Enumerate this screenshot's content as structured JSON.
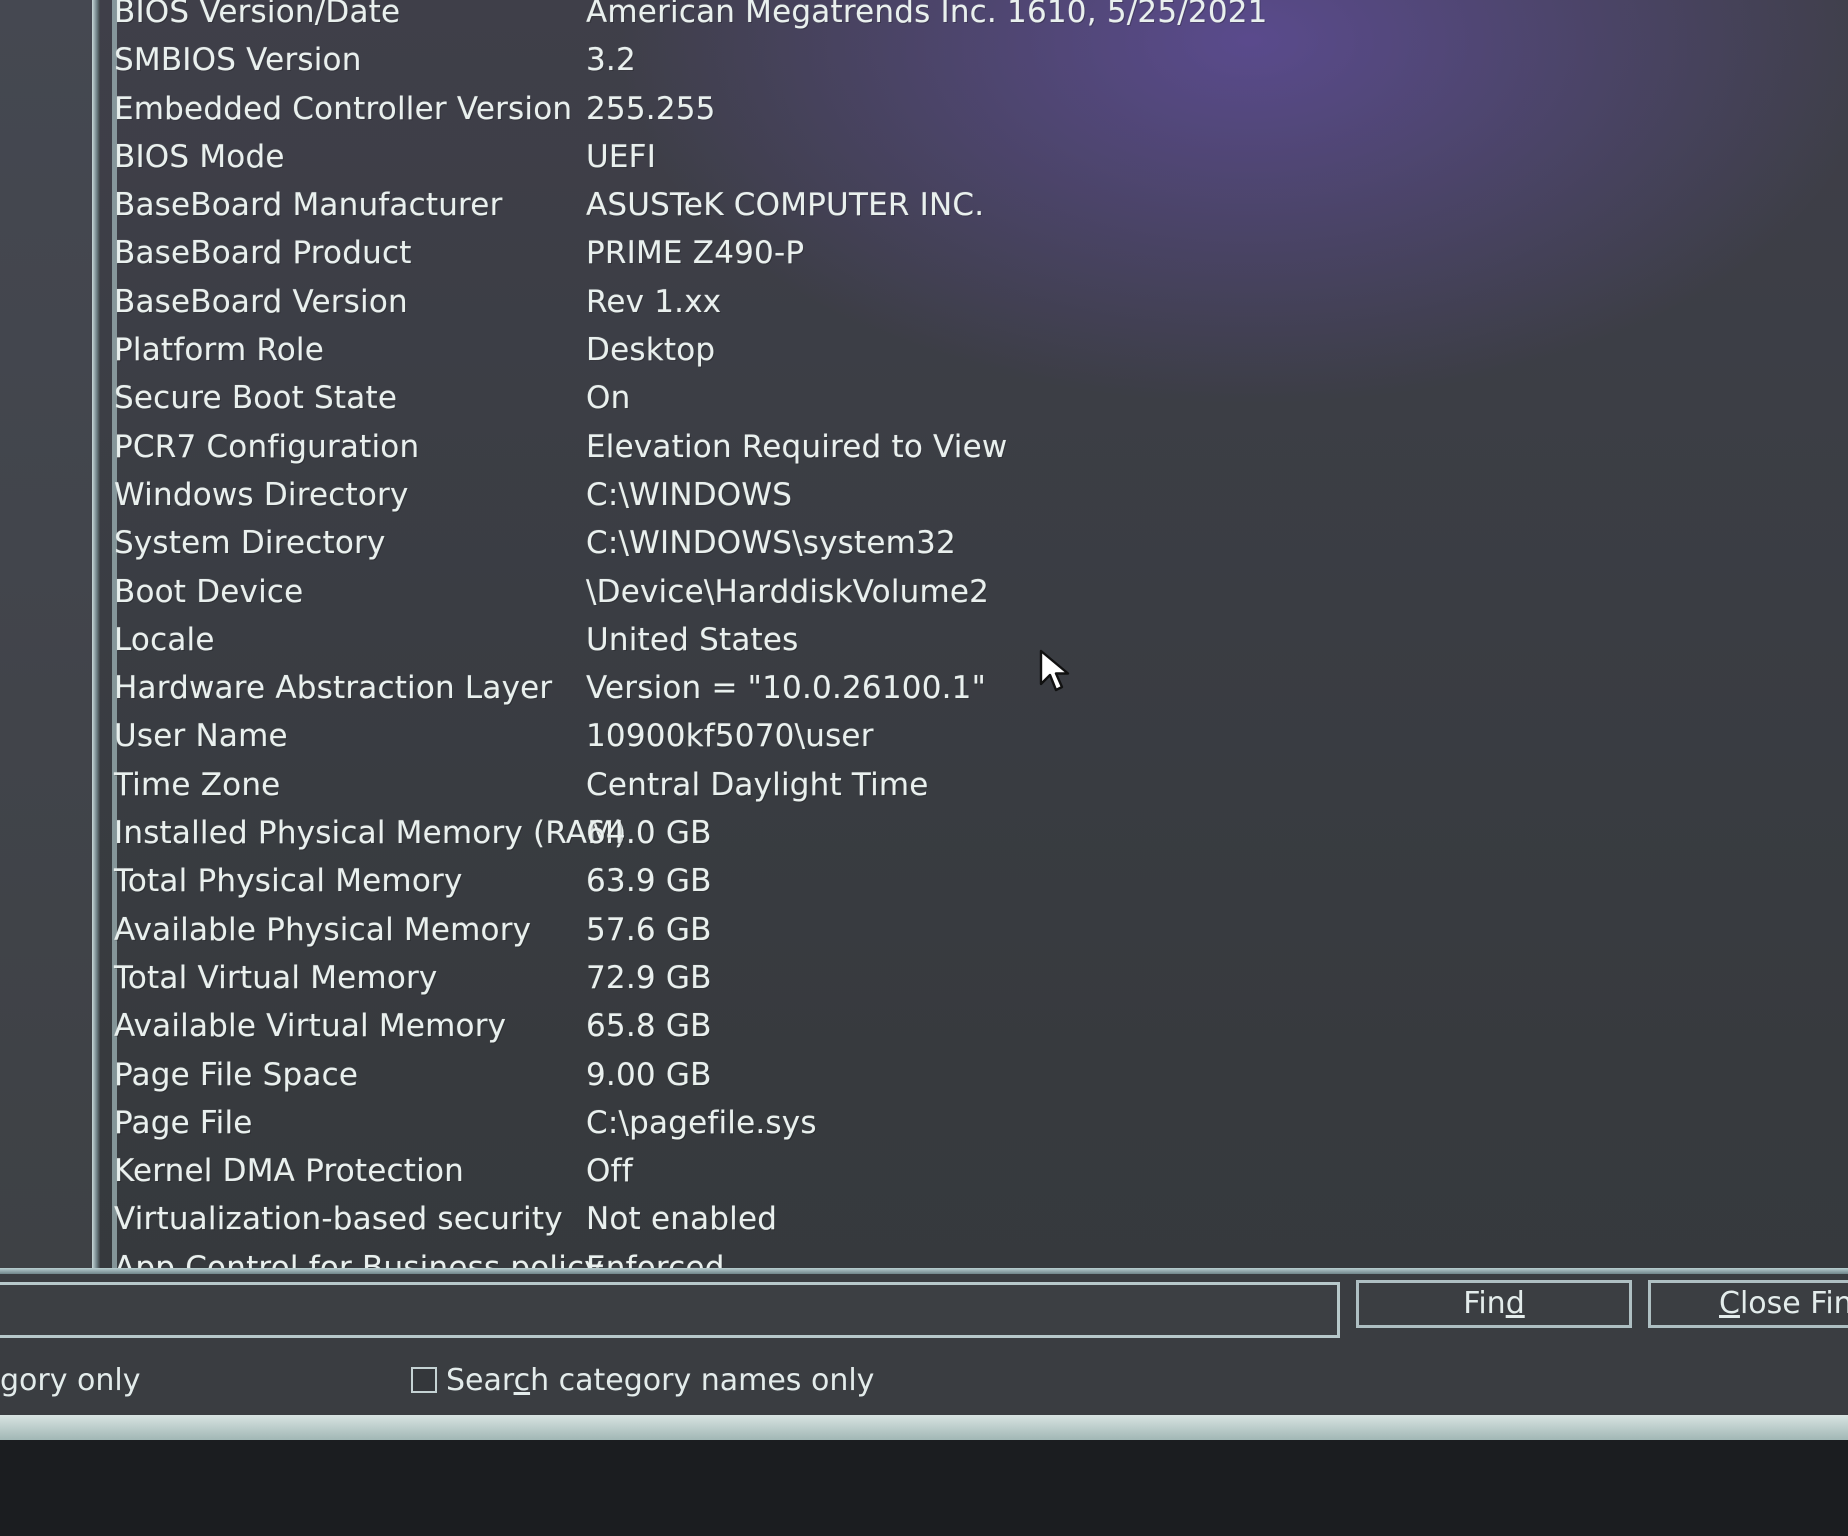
{
  "system_summary": {
    "rows": [
      {
        "item": "BIOS Version/Date",
        "value": "American Megatrends Inc. 1610, 5/25/2021"
      },
      {
        "item": "SMBIOS Version",
        "value": "3.2"
      },
      {
        "item": "Embedded Controller Version",
        "value": "255.255"
      },
      {
        "item": "BIOS Mode",
        "value": "UEFI"
      },
      {
        "item": "BaseBoard Manufacturer",
        "value": "ASUSTeK COMPUTER INC."
      },
      {
        "item": "BaseBoard Product",
        "value": "PRIME Z490-P"
      },
      {
        "item": "BaseBoard Version",
        "value": "Rev 1.xx"
      },
      {
        "item": "Platform Role",
        "value": "Desktop"
      },
      {
        "item": "Secure Boot State",
        "value": "On"
      },
      {
        "item": "PCR7 Configuration",
        "value": "Elevation Required to View"
      },
      {
        "item": "Windows Directory",
        "value": "C:\\WINDOWS"
      },
      {
        "item": "System Directory",
        "value": "C:\\WINDOWS\\system32"
      },
      {
        "item": "Boot Device",
        "value": "\\Device\\HarddiskVolume2"
      },
      {
        "item": "Locale",
        "value": "United States"
      },
      {
        "item": "Hardware Abstraction Layer",
        "value": "Version = \"10.0.26100.1\""
      },
      {
        "item": "User Name",
        "value": "10900kf5070\\user"
      },
      {
        "item": "Time Zone",
        "value": "Central Daylight Time"
      },
      {
        "item": "Installed Physical Memory (RAM)",
        "value": "64.0 GB"
      },
      {
        "item": "Total Physical Memory",
        "value": "63.9 GB"
      },
      {
        "item": "Available Physical Memory",
        "value": "57.6 GB"
      },
      {
        "item": "Total Virtual Memory",
        "value": "72.9 GB"
      },
      {
        "item": "Available Virtual Memory",
        "value": "65.8 GB"
      },
      {
        "item": "Page File Space",
        "value": "9.00 GB"
      },
      {
        "item": "Page File",
        "value": "C:\\pagefile.sys"
      },
      {
        "item": "Kernel DMA Protection",
        "value": "Off"
      },
      {
        "item": "Virtualization-based security",
        "value": "Not enabled"
      },
      {
        "item": "App Control for Business policy",
        "value": "Enforced"
      }
    ]
  },
  "find_bar": {
    "input_value": "",
    "find_button": {
      "prefix": "Fin",
      "accel": "d",
      "suffix": ""
    },
    "close_find_button": {
      "accel": "C",
      "rest": "lose Finc"
    },
    "option_category_only": "gory only",
    "option_category_names": {
      "prefix": "Sear",
      "accel": "c",
      "suffix": "h category names only"
    },
    "category_names_checked": false
  },
  "colors": {
    "text": "#e9f0ee",
    "window_background": "#3a3d41",
    "accent_glow": "#7054c4",
    "border": "#b7c8ca"
  },
  "icons": {
    "cursor": "mouse-pointer-icon"
  }
}
